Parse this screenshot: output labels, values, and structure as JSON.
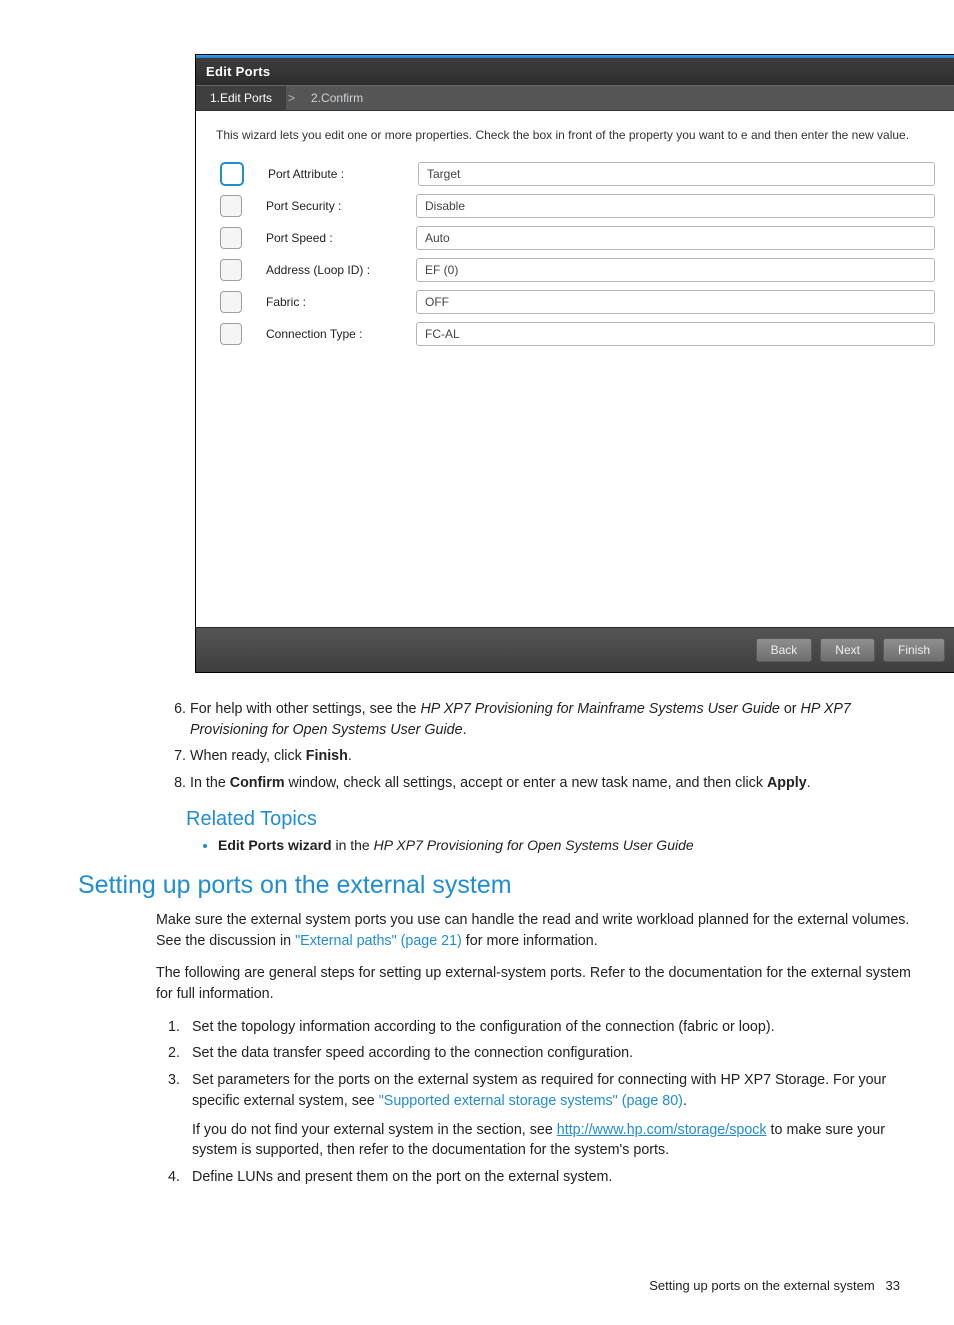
{
  "dialog": {
    "title": "Edit Ports",
    "crumb1": "1.Edit Ports",
    "crumb2": "2.Confirm",
    "arrow": ">",
    "desc": "This wizard lets you edit one or more properties. Check the  box in front of the property you want to e and then enter the new value.",
    "rows": {
      "r0": {
        "label": "Port Attribute :",
        "value": "Target"
      },
      "r1": {
        "label": "Port Security :",
        "value": "Disable"
      },
      "r2": {
        "label": "Port Speed :",
        "value": "Auto"
      },
      "r3": {
        "label": "Address (Loop ID) :",
        "value": "EF (0)"
      },
      "r4": {
        "label": "Fabric :",
        "value": "OFF"
      },
      "r5": {
        "label": "Connection Type :",
        "value": "FC-AL"
      }
    },
    "back": "Back",
    "next": "Next",
    "finish": "Finish"
  },
  "body": {
    "li6a": "For help with other settings, see the ",
    "li6b": "HP XP7 Provisioning for Mainframe Systems User Guide",
    "li6c": " or ",
    "li6d": "HP XP7 Provisioning for Open Systems User Guide",
    "li6e": ".",
    "li7a": "When ready, click ",
    "li7b": "Finish",
    "li7c": ".",
    "li8a": "In the ",
    "li8b": "Confirm",
    "li8c": " window, check all settings, accept or enter a new task name, and then click ",
    "li8d": "Apply",
    "li8e": ".",
    "related_h": "Related Topics",
    "rel_b": "Edit Ports wizard",
    "rel_a": " in the ",
    "rel_i": "HP XP7 Provisioning for Open Systems User Guide",
    "h2": "Setting up ports on the external system",
    "p1a": "Make sure the external system ports you use can handle the read and write workload planned for the external volumes. See the discussion in ",
    "p1link": "\"External paths\" (page 21)",
    "p1b": " for more information.",
    "p2": "The following are general steps for setting up external-system ports. Refer to the documentation for the external system for full information.",
    "o1": "Set the topology information according to the configuration of the connection (fabric or loop).",
    "o2": "Set the data transfer speed according to the connection configuration.",
    "o3a": "Set parameters for the ports on the external system as required for connecting with HP XP7 Storage. For your specific external system, see ",
    "o3link": "\"Supported external storage systems\" (page 80)",
    "o3b": ".",
    "o3c": "If you do not find your external system in the section, see ",
    "o3url": "http://www.hp.com/storage/spock",
    "o3d": " to make sure your system is supported, then refer to the documentation for the system's ports.",
    "o4": "Define LUNs and present them on the port on the external system."
  },
  "footer": {
    "text": "Setting up ports on the external system",
    "page": "33"
  }
}
